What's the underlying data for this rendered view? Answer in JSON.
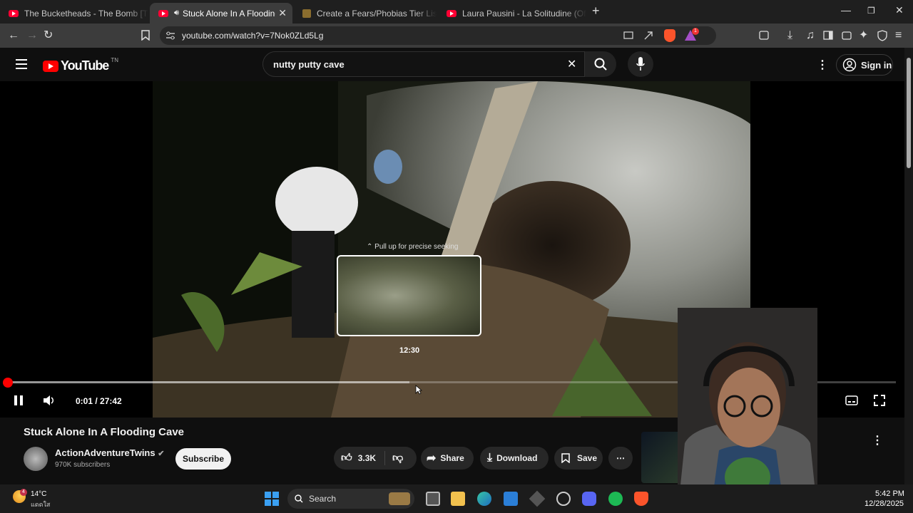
{
  "browser": {
    "tabs": [
      {
        "title": "The Bucketheads - The Bomb [These",
        "active": false
      },
      {
        "title": "Stuck Alone In A Flooding Cav",
        "active": true
      },
      {
        "title": "Create a Fears/Phobias Tier List - Tier",
        "active": false
      },
      {
        "title": "Laura Pausini - La Solitudine (Official",
        "active": false
      }
    ],
    "new_tab_label": "+",
    "url": "youtube.com/watch?v=7Nok0ZLd5Lg",
    "badges": {
      "brave_count": "",
      "alert_count": "1"
    }
  },
  "youtube": {
    "logo_text": "YouTube",
    "logo_suffix": "TN",
    "search_value": "nutty putty cave",
    "sign_in_label": "Sign in"
  },
  "player": {
    "pull_hint": "Pull up for precise seeking",
    "preview_time": "12:30",
    "time_display": "0:01 / 27:42",
    "progress_fraction": 0.001
  },
  "video": {
    "title": "Stuck Alone In A Flooding Cave",
    "channel_name": "ActionAdventureTwins",
    "subscribers": "970K subscribers",
    "subscribe_label": "Subscribe",
    "likes": "3.3K",
    "share_label": "Share",
    "download_label": "Download",
    "save_label": "Save"
  },
  "taskbar": {
    "weather_temp": "14°C",
    "weather_desc": "แดดใส",
    "weather_badge": "4",
    "search_label": "Search",
    "time": "5:42 PM",
    "date": "12/28/2025"
  },
  "colors": {
    "accent": "#ff0000",
    "background": "#0f0f0f",
    "pill": "#272727"
  }
}
